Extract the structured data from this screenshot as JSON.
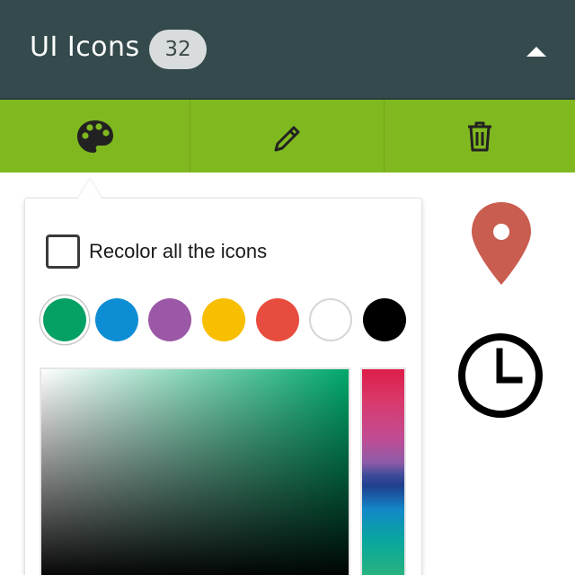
{
  "header": {
    "title": "UI Icons",
    "count": "32",
    "collapse_icon": "chevron-up-icon"
  },
  "toolbar": {
    "buttons": [
      {
        "icon": "palette-icon"
      },
      {
        "icon": "pencil-icon"
      },
      {
        "icon": "trash-icon"
      }
    ]
  },
  "color_popover": {
    "recolor_label": "Recolor all the icons",
    "recolor_checked": false,
    "swatches": [
      {
        "color": "#05a064",
        "selected": true
      },
      {
        "color": "#0d8dd4",
        "selected": false
      },
      {
        "color": "#9b58a6",
        "selected": false
      },
      {
        "color": "#f8be00",
        "selected": false
      },
      {
        "color": "#e84c3f",
        "selected": false
      },
      {
        "color": "#ffffff",
        "selected": false
      },
      {
        "color": "#000000",
        "selected": false
      }
    ],
    "picker_hue_color": "#00a86b"
  },
  "icons": [
    {
      "name": "map-pin-icon",
      "color": "#c95d4f"
    },
    {
      "name": "clock-icon",
      "color": "#000000"
    }
  ],
  "colors": {
    "header_bg": "#344a4c",
    "toolbar_bg": "#80b81f"
  }
}
